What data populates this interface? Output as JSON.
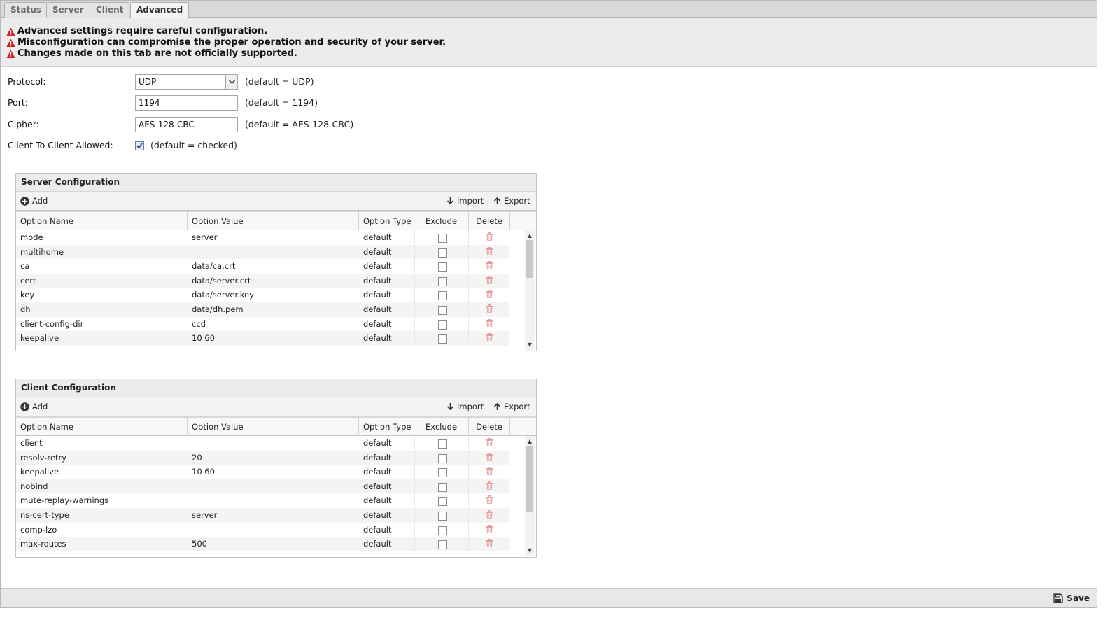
{
  "tabs": [
    {
      "label": "Status"
    },
    {
      "label": "Server"
    },
    {
      "label": "Client"
    },
    {
      "label": "Advanced"
    }
  ],
  "warnings": [
    "Advanced settings require careful configuration.",
    "Misconfiguration can compromise the proper operation and security of your server.",
    "Changes made on this tab are not officially supported."
  ],
  "form": {
    "protocol": {
      "label": "Protocol:",
      "value": "UDP",
      "hint": "(default = UDP)"
    },
    "port": {
      "label": "Port:",
      "value": "1194",
      "hint": "(default = 1194)"
    },
    "cipher": {
      "label": "Cipher:",
      "value": "AES-128-CBC",
      "hint": "(default = AES-128-CBC)"
    },
    "client_to_client": {
      "label": "Client To Client Allowed:",
      "checked": true,
      "hint": "(default = checked)"
    }
  },
  "toolbar": {
    "add": "Add",
    "import": "Import",
    "export": "Export"
  },
  "columns": [
    "Option Name",
    "Option Value",
    "Option Type",
    "Exclude",
    "Delete"
  ],
  "server": {
    "title": "Server Configuration",
    "rows": [
      {
        "name": "mode",
        "value": "server",
        "type": "default"
      },
      {
        "name": "multihome",
        "value": "",
        "type": "default"
      },
      {
        "name": "ca",
        "value": "data/ca.crt",
        "type": "default"
      },
      {
        "name": "cert",
        "value": "data/server.crt",
        "type": "default"
      },
      {
        "name": "key",
        "value": "data/server.key",
        "type": "default"
      },
      {
        "name": "dh",
        "value": "data/dh.pem",
        "type": "default"
      },
      {
        "name": "client-config-dir",
        "value": "ccd",
        "type": "default"
      },
      {
        "name": "keepalive",
        "value": "10 60",
        "type": "default"
      }
    ]
  },
  "client": {
    "title": "Client Configuration",
    "rows": [
      {
        "name": "client",
        "value": "",
        "type": "default"
      },
      {
        "name": "resolv-retry",
        "value": "20",
        "type": "default"
      },
      {
        "name": "keepalive",
        "value": "10 60",
        "type": "default"
      },
      {
        "name": "nobind",
        "value": "",
        "type": "default"
      },
      {
        "name": "mute-replay-warnings",
        "value": "",
        "type": "default"
      },
      {
        "name": "ns-cert-type",
        "value": "server",
        "type": "default"
      },
      {
        "name": "comp-lzo",
        "value": "",
        "type": "default"
      },
      {
        "name": "max-routes",
        "value": "500",
        "type": "default"
      }
    ]
  },
  "footer": {
    "save": "Save"
  },
  "colors": {
    "warning": "#d0201d",
    "trash": "#e59a9a"
  }
}
